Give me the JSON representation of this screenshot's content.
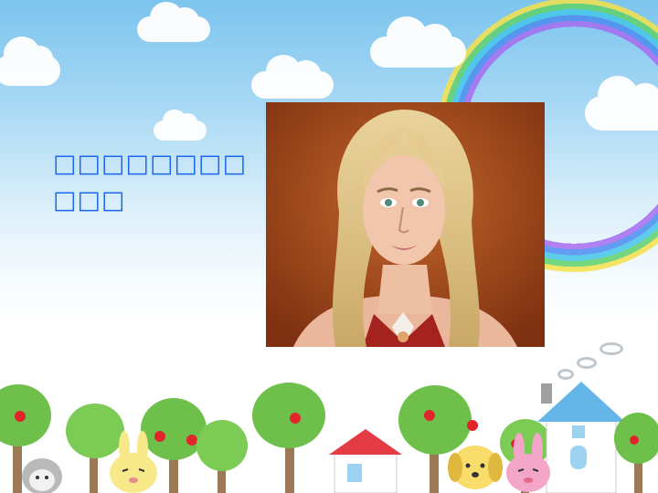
{
  "slide": {
    "text_line1": "□□□□□□□□",
    "text_line2": "□□□"
  },
  "colors": {
    "text": "#1a66f2",
    "sky_top": "#7cc4ee",
    "tree_green": "#6fc04a",
    "apple_red": "#e0262b",
    "photo_background": "#a84a18"
  },
  "icons": [
    "cloud",
    "rainbow",
    "tree",
    "apple",
    "house",
    "bunny",
    "dog",
    "sheep"
  ]
}
